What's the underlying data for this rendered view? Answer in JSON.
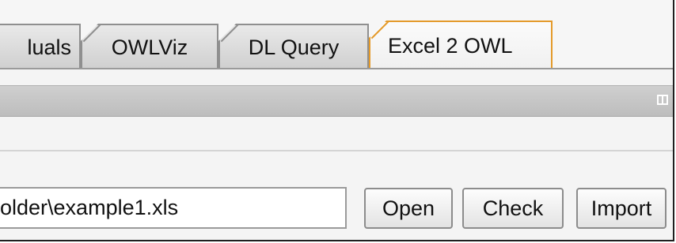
{
  "tabs": [
    {
      "label": "luals"
    },
    {
      "label": "OWLViz"
    },
    {
      "label": "DL Query"
    },
    {
      "label": "Excel 2 OWL"
    }
  ],
  "file_input": {
    "value": "older\\example1.xls"
  },
  "buttons": {
    "open": "Open",
    "check": "Check",
    "import": "Import"
  },
  "accent_color": "#e49a2a"
}
